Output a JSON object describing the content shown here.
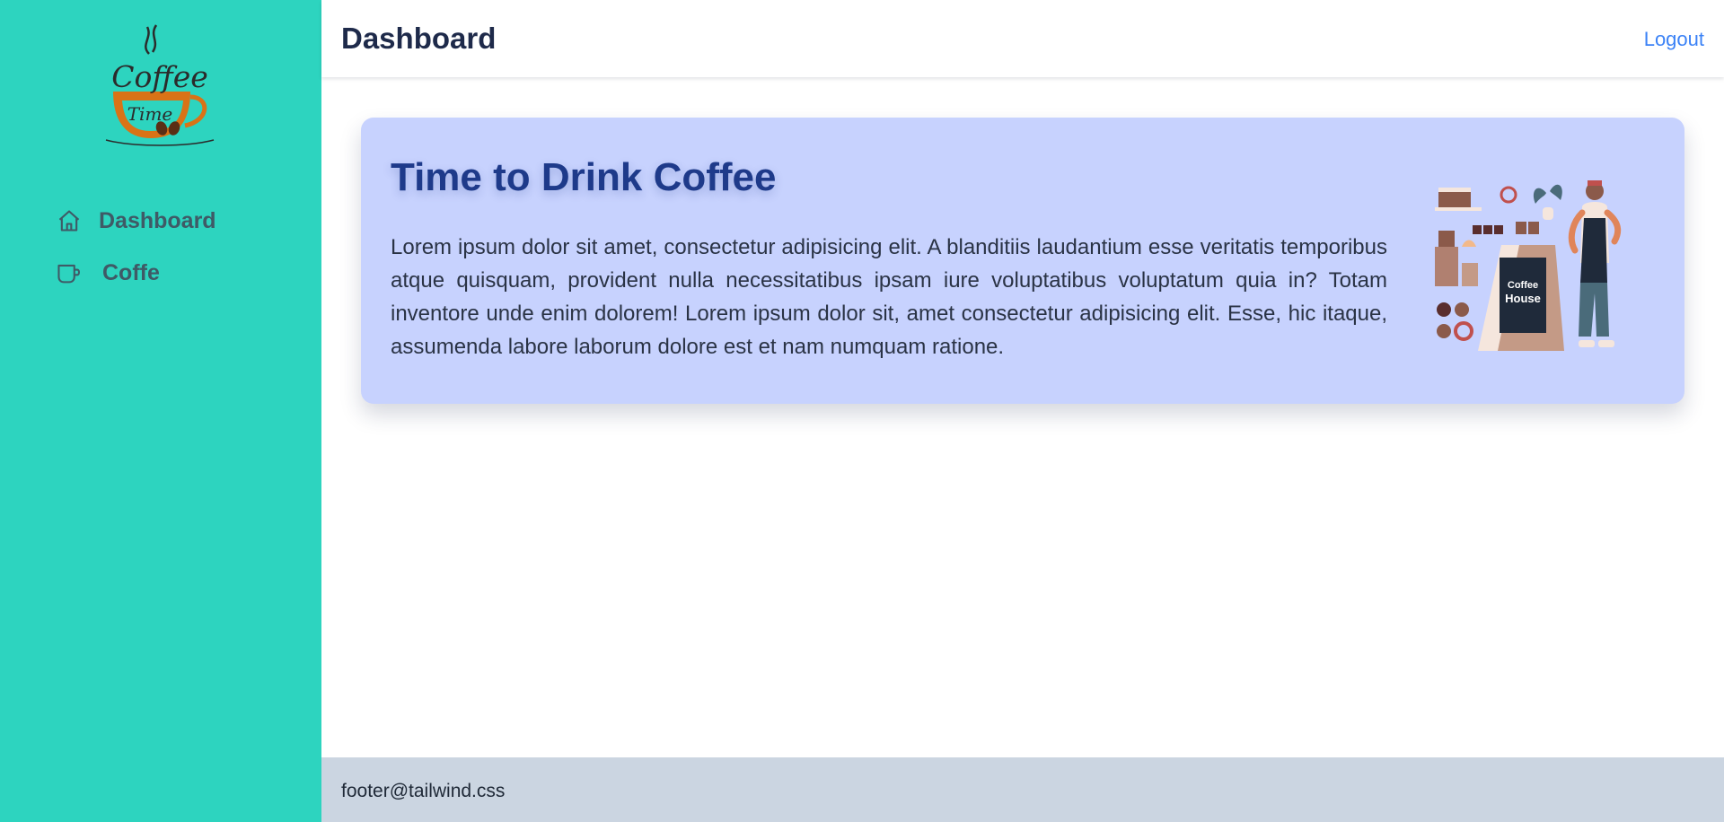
{
  "sidebar": {
    "logo": {
      "word1": "Coffee",
      "word2": "Time"
    },
    "items": [
      {
        "label": "Dashboard",
        "icon": "home-icon"
      },
      {
        "label": "Coffe",
        "icon": "coffee-cup-icon"
      }
    ]
  },
  "header": {
    "title": "Dashboard",
    "logout_label": "Logout"
  },
  "hero": {
    "title": "Time to Drink Coffee",
    "body": "Lorem ipsum dolor sit amet, consectetur adipisicing elit. A blanditiis laudantium esse veritatis temporibus atque quisquam, provident nulla necessitatibus ipsam iure voluptatibus voluptatum quia in? Totam inventore unde enim dolorem! Lorem ipsum dolor sit, amet consectetur adipisicing elit. Esse, hic itaque, assumenda labore laborum dolore est et nam numquam ratione.",
    "illustration": {
      "sign_line1": "Coffee",
      "sign_line2": "House"
    }
  },
  "footer": {
    "text": "footer@tailwind.css"
  },
  "colors": {
    "sidebar_bg": "#2dd4bf",
    "card_bg": "#c7d2fe",
    "accent_link": "#3b82f6",
    "title_blue": "#1e3a8a",
    "footer_bg": "#cbd5e1"
  }
}
